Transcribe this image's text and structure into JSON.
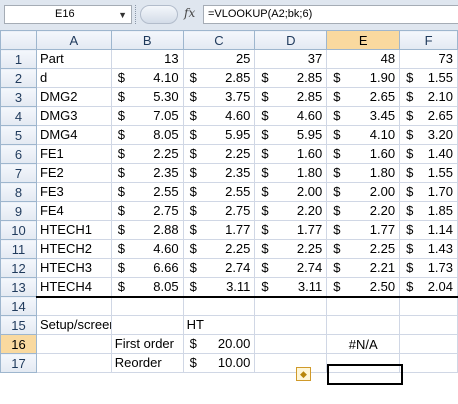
{
  "formula_bar": {
    "cell_ref": "E16",
    "fx_label": "fx",
    "formula": "=VLOOKUP(A2;bk;6)"
  },
  "columns": [
    "A",
    "B",
    "C",
    "D",
    "E",
    "F"
  ],
  "selected_column": "E",
  "selected_row": "16",
  "rows": [
    {
      "n": "1",
      "a": "Part",
      "b": "13",
      "c": "25",
      "d": "37",
      "e": "48",
      "f": "73"
    },
    {
      "n": "2",
      "a": "d",
      "b": "4.10",
      "c": "2.85",
      "d": "2.85",
      "e": "1.90",
      "f": "1.55"
    },
    {
      "n": "3",
      "a": "DMG2",
      "b": "5.30",
      "c": "3.75",
      "d": "2.85",
      "e": "2.65",
      "f": "2.10"
    },
    {
      "n": "4",
      "a": "DMG3",
      "b": "7.05",
      "c": "4.60",
      "d": "4.60",
      "e": "3.45",
      "f": "2.65"
    },
    {
      "n": "5",
      "a": "DMG4",
      "b": "8.05",
      "c": "5.95",
      "d": "5.95",
      "e": "4.10",
      "f": "3.20"
    },
    {
      "n": "6",
      "a": "FE1",
      "b": "2.25",
      "c": "2.25",
      "d": "1.60",
      "e": "1.60",
      "f": "1.40"
    },
    {
      "n": "7",
      "a": "FE2",
      "b": "2.35",
      "c": "2.35",
      "d": "1.80",
      "e": "1.80",
      "f": "1.55"
    },
    {
      "n": "8",
      "a": "FE3",
      "b": "2.55",
      "c": "2.55",
      "d": "2.00",
      "e": "2.00",
      "f": "1.70"
    },
    {
      "n": "9",
      "a": "FE4",
      "b": "2.75",
      "c": "2.75",
      "d": "2.20",
      "e": "2.20",
      "f": "1.85"
    },
    {
      "n": "10",
      "a": "HTECH1",
      "b": "2.88",
      "c": "1.77",
      "d": "1.77",
      "e": "1.77",
      "f": "1.14"
    },
    {
      "n": "11",
      "a": "HTECH2",
      "b": "4.60",
      "c": "2.25",
      "d": "2.25",
      "e": "2.25",
      "f": "1.43"
    },
    {
      "n": "12",
      "a": "HTECH3",
      "b": "6.66",
      "c": "2.74",
      "d": "2.74",
      "e": "2.21",
      "f": "1.73"
    },
    {
      "n": "13",
      "a": "HTECH4",
      "b": "8.05",
      "c": "3.11",
      "d": "3.11",
      "e": "2.50",
      "f": "2.04"
    }
  ],
  "currency_symbol": "$",
  "row14": {
    "n": "14"
  },
  "row15": {
    "n": "15",
    "a": "Setup/screens:",
    "c": "HT"
  },
  "row16": {
    "n": "16",
    "b": "First order",
    "c": "20.00",
    "e": "#N/A"
  },
  "row17": {
    "n": "17",
    "b": "Reorder",
    "c": "10.00"
  },
  "error_icon": "warning-diamond-icon"
}
